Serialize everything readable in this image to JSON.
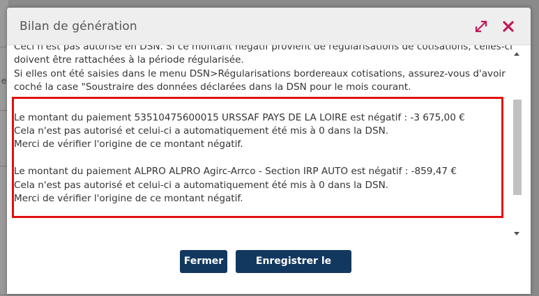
{
  "dialog": {
    "title": "Bilan de génération",
    "expand_icon": "expand-arrows-icon",
    "close_icon": "close-x-icon",
    "accent_color": "#c2185b"
  },
  "content": {
    "lines_top": [
      "Ceci n'est pas autorisé en DSN. Si ce montant négatif provient de régularisations de cotisations, celles-ci",
      "doivent être rattachées à la période régularisée.",
      "Si elles ont été saisies dans le menu DSN>Régularisations bordereaux cotisations, assurez-vous d'avoir",
      "coché la case \"Soustraire des données déclarées dans la DSN pour le mois courant."
    ],
    "block1": [
      "Le montant du paiement 53510475600015 URSSAF PAYS DE LA LOIRE est négatif : -3 675,00 €",
      "Cela n'est pas autorisé et celui-ci a automatiquement été mis à 0 dans la DSN.",
      "Merci de vérifier l'origine de ce montant négatif."
    ],
    "block2": [
      "Le montant du paiement ALPRO ALPRO Agirc-Arrco - Section IRP AUTO est négatif : -859,47 €",
      "Cela n'est pas autorisé et celui-ci a automatiquement été mis à 0 dans la DSN.",
      "Merci de vérifier l'origine de ce montant négatif."
    ],
    "highlight_color": "#e01010"
  },
  "footer": {
    "close_label": "Fermer",
    "save_label": "Enregistrer le rapport",
    "button_color": "#12385f"
  },
  "background": {
    "partial_char": "e"
  }
}
